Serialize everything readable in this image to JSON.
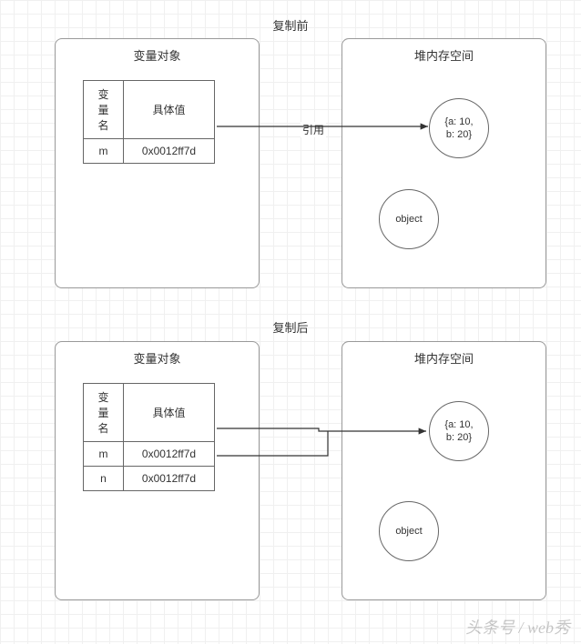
{
  "before": {
    "title": "复制前",
    "left_panel_title": "变量对象",
    "right_panel_title": "堆内存空间",
    "table": {
      "col_name": "变量名",
      "col_value": "具体值",
      "rows": [
        {
          "name": "m",
          "value": "0x0012ff7d"
        }
      ]
    },
    "arrow_label": "引用",
    "heap_object": "{a: 10,\nb: 20}",
    "heap_label": "object"
  },
  "after": {
    "title": "复制后",
    "left_panel_title": "变量对象",
    "right_panel_title": "堆内存空间",
    "table": {
      "col_name": "变量名",
      "col_value": "具体值",
      "rows": [
        {
          "name": "m",
          "value": "0x0012ff7d"
        },
        {
          "name": "n",
          "value": "0x0012ff7d"
        }
      ]
    },
    "heap_object": "{a: 10,\nb: 20}",
    "heap_label": "object"
  },
  "watermark": "头条号 / web秀",
  "chart_data": {
    "type": "diagram",
    "description": "JavaScript reference-type variable copy: before and after assigning m to n, both point to the same heap object",
    "scenes": [
      {
        "phase": "before",
        "variable_object": {
          "m": "0x0012ff7d"
        },
        "heap": {
          "0x0012ff7d": {
            "a": 10,
            "b": 20
          }
        },
        "references": [
          {
            "var": "m",
            "address": "0x0012ff7d",
            "label": "引用"
          }
        ]
      },
      {
        "phase": "after",
        "variable_object": {
          "m": "0x0012ff7d",
          "n": "0x0012ff7d"
        },
        "heap": {
          "0x0012ff7d": {
            "a": 10,
            "b": 20
          }
        },
        "references": [
          {
            "var": "m",
            "address": "0x0012ff7d"
          },
          {
            "var": "n",
            "address": "0x0012ff7d"
          }
        ]
      }
    ]
  }
}
